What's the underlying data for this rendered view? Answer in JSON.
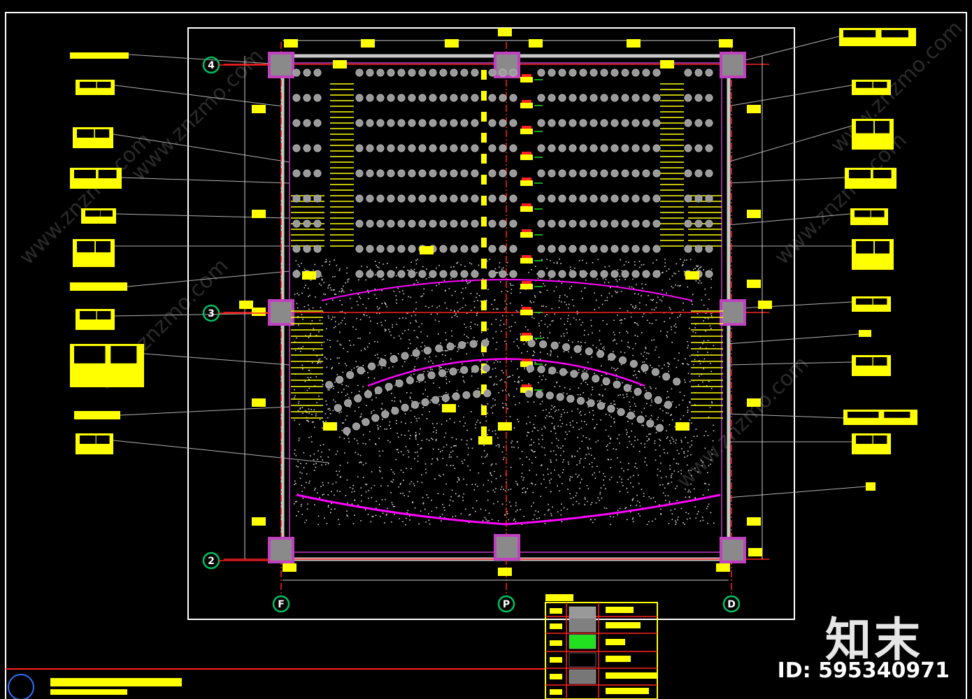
{
  "grid_labels": {
    "rows": [
      "4",
      "3",
      "2"
    ],
    "cols": [
      "F",
      "P",
      "D"
    ]
  },
  "watermark_text": "www.znzmo.com",
  "brand": {
    "logo_text": "知末",
    "id_text": "ID: 595340971"
  },
  "colors": {
    "background": "#000000",
    "annotation": "#ffff00",
    "wall": "#c8c8c8",
    "column": "#c040c0",
    "axis": "#ff2020",
    "stage_edge": "#ff00ff",
    "grid_bubble": "#00c060",
    "seat": "#9a9a9a"
  }
}
